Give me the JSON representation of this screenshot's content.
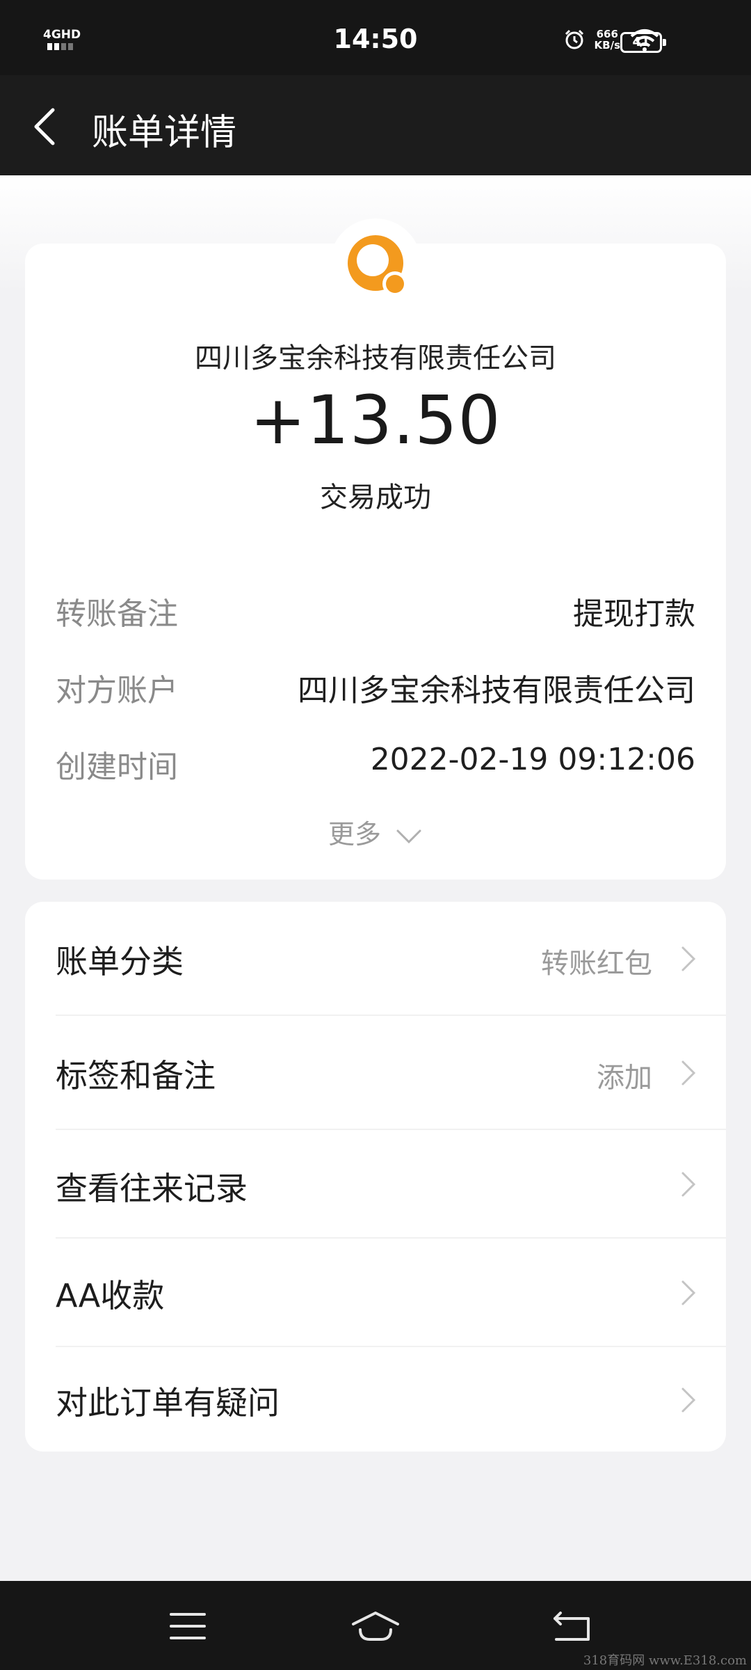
{
  "status_bar": {
    "network": "4GHD",
    "time": "14:50",
    "speed_value": "666",
    "speed_unit": "KB/s",
    "battery": "41",
    "icons": [
      "signal-icon",
      "alarm-icon",
      "wifi-icon",
      "battery-icon"
    ]
  },
  "header": {
    "back_icon": "chevron-left-icon",
    "title": "账单详情"
  },
  "summary": {
    "logo_icon": "orange-ring-logo-icon",
    "payee": "四川多宝余科技有限责任公司",
    "amount": "+13.50",
    "status": "交易成功"
  },
  "details": [
    {
      "label": "转账备注",
      "value": "提现打款"
    },
    {
      "label": "对方账户",
      "value": "四川多宝余科技有限责任公司"
    },
    {
      "label": "创建时间",
      "value": "2022-02-19 09:12:06"
    }
  ],
  "more_label": "更多",
  "menu": [
    {
      "label": "账单分类",
      "value": "转账红包"
    },
    {
      "label": "标签和备注",
      "value": "添加"
    },
    {
      "label": "查看往来记录",
      "value": ""
    },
    {
      "label": "AA收款",
      "value": ""
    },
    {
      "label": "对此订单有疑问",
      "value": ""
    }
  ],
  "system_nav": [
    "menu-icon",
    "home-icon",
    "back-icon"
  ],
  "watermark": "318育码网 www.E318.com",
  "colors": {
    "accent_orange": "#f39a1e",
    "header_bg": "#1c1c1c",
    "page_bg": "#f2f2f4"
  }
}
